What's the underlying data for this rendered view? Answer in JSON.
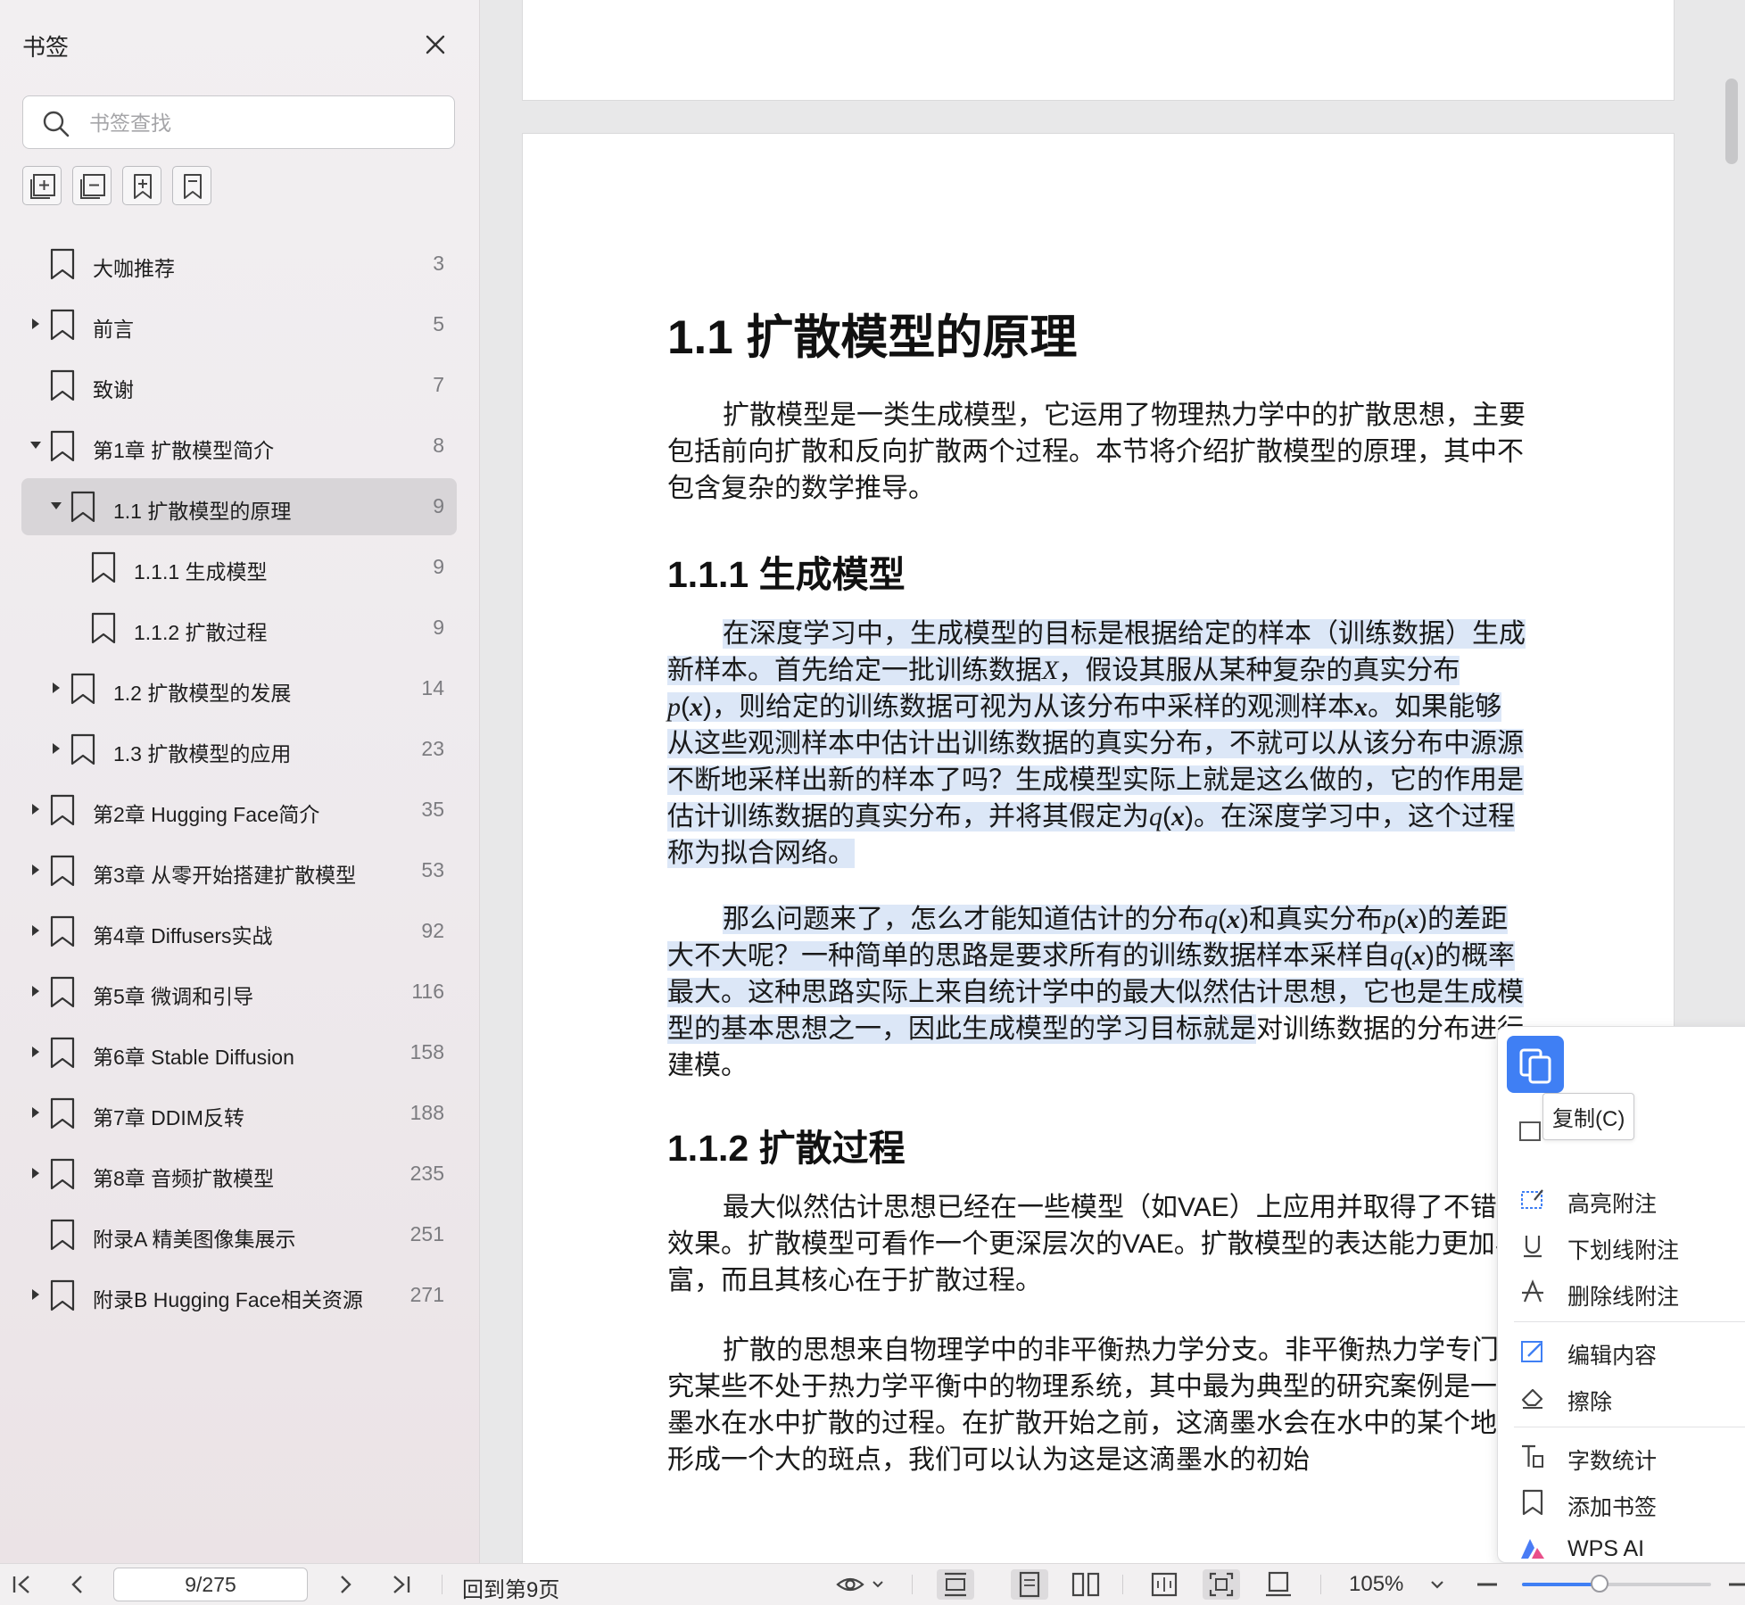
{
  "sidebar": {
    "title": "书签",
    "search_placeholder": "书签查找",
    "toolbar_icons": [
      "expand-all-icon",
      "collapse-all-icon",
      "add-child-bookmark-icon",
      "add-bookmark-icon"
    ],
    "items": [
      {
        "label": "大咖推荐",
        "page": "3",
        "caret": ""
      },
      {
        "label": "前言",
        "page": "5",
        "caret": "right"
      },
      {
        "label": "致谢",
        "page": "7",
        "caret": ""
      },
      {
        "label": "第1章 扩散模型简介",
        "page": "8",
        "caret": "down"
      },
      {
        "label": "1.1 扩散模型的原理",
        "page": "9",
        "caret": "down",
        "selected": true
      },
      {
        "label": "1.1.1 生成模型",
        "page": "9",
        "caret": ""
      },
      {
        "label": "1.1.2 扩散过程",
        "page": "9",
        "caret": ""
      },
      {
        "label": "1.2 扩散模型的发展",
        "page": "14",
        "caret": "right"
      },
      {
        "label": "1.3 扩散模型的应用",
        "page": "23",
        "caret": "right"
      },
      {
        "label": "第2章 Hugging Face简介",
        "page": "35",
        "caret": "right"
      },
      {
        "label": "第3章 从零开始搭建扩散模型",
        "page": "53",
        "caret": "right"
      },
      {
        "label": "第4章 Diffusers实战",
        "page": "92",
        "caret": "right"
      },
      {
        "label": "第5章 微调和引导",
        "page": "116",
        "caret": "right"
      },
      {
        "label": "第6章 Stable Diffusion",
        "page": "158",
        "caret": "right"
      },
      {
        "label": "第7章 DDIM反转",
        "page": "188",
        "caret": "right"
      },
      {
        "label": "第8章 音频扩散模型",
        "page": "235",
        "caret": "right"
      },
      {
        "label": "附录A 精美图像集展示",
        "page": "251",
        "caret": ""
      },
      {
        "label": "附录B Hugging Face相关资源",
        "page": "271",
        "caret": "right"
      }
    ]
  },
  "document": {
    "h1": "1.1 扩散模型的原理",
    "p1": "扩散模型是一类生成模型，它运用了物理热力学中的扩散思想，主要包括前向扩散和反向扩散两个过程。本节将介绍扩散模型的原理，其中不包含复杂的数学推导。",
    "h2_a": "1.1.1 生成模型",
    "p2": {
      "t1": "在深度学习中，生成模型的目标是根据给定的样本（训练数据）生成新样本。首先给定一批训练数据",
      "v1": "X",
      "t2": "，假设其服从某种复杂的真实分布",
      "v2": "p",
      "v3": "x",
      "t3": "，则给定的训练数据可视为从该分布中采样的观测样本",
      "v4": "x",
      "t4": "。如果能够从这些观测样本中估计出训练数据的真实分布，不就可以从该分布中源源不断地采样出新的样本了吗？生成模型实际上就是这么做的，它的作用是估计训练数据的真实分布，并将其假定为",
      "v5": "q",
      "v6": "x",
      "t5": "。在深度学习中，这个过程称为拟合网络。"
    },
    "p3": {
      "t1": "那么问题来了，怎么才能知道估计的分布",
      "v1": "q",
      "v2": "x",
      "t2": "和真实分布",
      "v3": "p",
      "v4": "x",
      "t3": "的差距大不大呢？一种简单的思路是要求所有的训练数据样本采样自",
      "v5": "q",
      "v6": "x",
      "t4": "的概率最大。这种思路实际上来自统计学中的最大似然估计思想，它也是生成模型的基本思想之一，因此生成模型的学习目标就是",
      "t5": "对训练数据的分布进行建模。"
    },
    "h2_b": "1.1.2 扩散过程",
    "p4": "最大似然估计思想已经在一些模型（如VAE）上应用并取得了不错的效果。扩散模型可看作一个更深层次的VAE。扩散模型的表达能力更加丰富，而且其核心在于扩散过程。",
    "p5": "扩散的思想来自物理学中的非平衡热力学分支。非平衡热力学专门研究某些不处于热力学平衡中的物理系统，其中最为典型的研究案例是一滴墨水在水中扩散的过程。在扩散开始之前，这滴墨水会在水中的某个地方形成一个大的斑点，我们可以认为这是这滴墨水的初始"
  },
  "context_menu": {
    "copy_tooltip": "复制(C)",
    "items": [
      {
        "label": "高亮附注",
        "icon": "highlight-note-icon"
      },
      {
        "label": "下划线附注",
        "icon": "underline-note-icon"
      },
      {
        "label": "删除线附注",
        "icon": "strikethrough-note-icon"
      },
      {
        "label": "编辑内容",
        "icon": "edit-content-icon"
      },
      {
        "label": "擦除",
        "icon": "eraser-icon"
      },
      {
        "label": "字数统计",
        "icon": "word-count-icon"
      },
      {
        "label": "添加书签",
        "icon": "bookmark-icon"
      },
      {
        "label": "WPS AI",
        "icon": "wps-ai-icon"
      }
    ]
  },
  "bottombar": {
    "page_indicator": "9/275",
    "back_to_page": "回到第9页",
    "zoom": "105%",
    "zoom_fraction": 0.41
  },
  "colors": {
    "accent": "#3f7ff4",
    "selection": "#dce7f7",
    "sidebar_selected": "#d8d5d8"
  }
}
